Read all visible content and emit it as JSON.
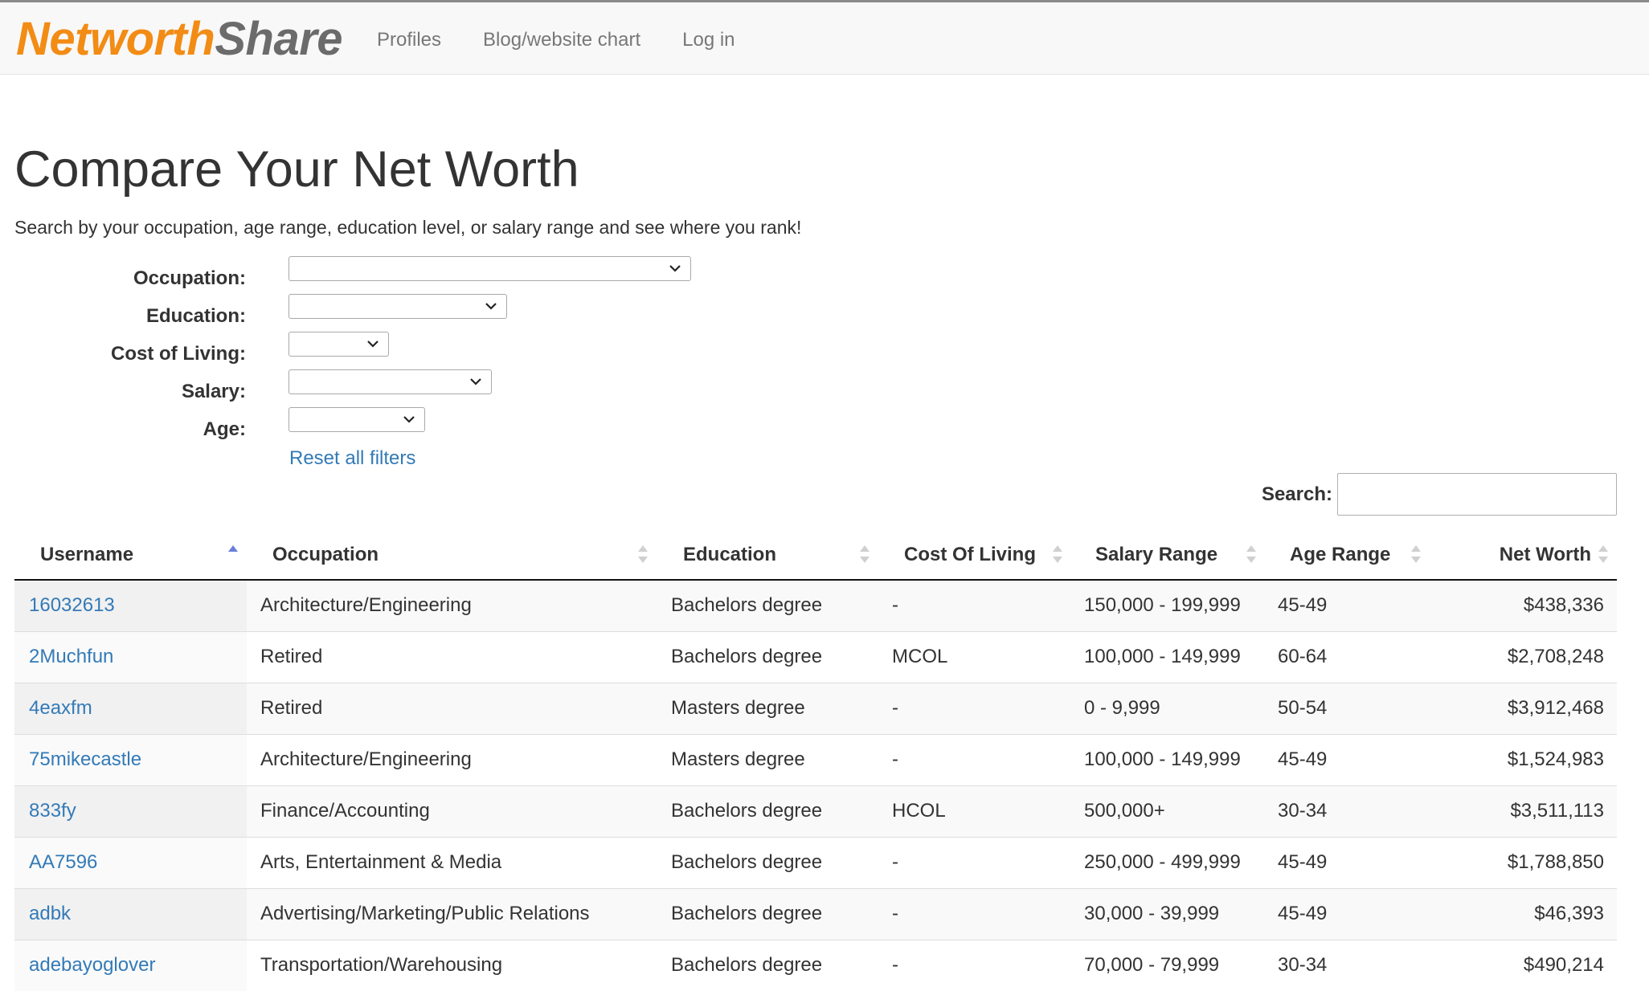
{
  "brand": {
    "part1": "Networth",
    "part2": "Share"
  },
  "nav": {
    "items": [
      "Profiles",
      "Blog/website chart",
      "Log in"
    ]
  },
  "page": {
    "title": "Compare Your Net Worth",
    "subtitle": "Search by your occupation, age range, education level, or salary range and see where you rank!"
  },
  "filters": {
    "occupation_label": "Occupation:",
    "education_label": "Education:",
    "cost_of_living_label": "Cost of Living:",
    "salary_label": "Salary:",
    "age_label": "Age:",
    "reset_label": "Reset all filters"
  },
  "search": {
    "label": "Search:",
    "value": ""
  },
  "table": {
    "columns": [
      "Username",
      "Occupation",
      "Education",
      "Cost Of Living",
      "Salary Range",
      "Age Range",
      "Net Worth"
    ],
    "sorted_column": "Username",
    "sort_direction": "ascending",
    "rows": [
      [
        "16032613",
        "Architecture/Engineering",
        "Bachelors degree",
        "-",
        "150,000 - 199,999",
        "45-49",
        "$438,336"
      ],
      [
        "2Muchfun",
        "Retired",
        "Bachelors degree",
        "MCOL",
        "100,000 - 149,999",
        "60-64",
        "$2,708,248"
      ],
      [
        "4eaxfm",
        "Retired",
        "Masters degree",
        "-",
        "0 - 9,999",
        "50-54",
        "$3,912,468"
      ],
      [
        "75mikecastle",
        "Architecture/Engineering",
        "Masters degree",
        "-",
        "100,000 - 149,999",
        "45-49",
        "$1,524,983"
      ],
      [
        "833fy",
        "Finance/Accounting",
        "Bachelors degree",
        "HCOL",
        "500,000+",
        "30-34",
        "$3,511,113"
      ],
      [
        "AA7596",
        "Arts, Entertainment & Media",
        "Bachelors degree",
        "-",
        "250,000 - 499,999",
        "45-49",
        "$1,788,850"
      ],
      [
        "adbk",
        "Advertising/Marketing/Public Relations",
        "Bachelors degree",
        "-",
        "30,000 - 39,999",
        "45-49",
        "$46,393"
      ],
      [
        "adebayoglover",
        "Transportation/Warehousing",
        "Bachelors degree",
        "-",
        "70,000 - 79,999",
        "30-34",
        "$490,214"
      ]
    ]
  },
  "colors": {
    "brand_orange": "#f28c15",
    "brand_gray": "#6b6b6b",
    "link_blue": "#337ab7",
    "sort_active": "#6b7fd7",
    "sort_inactive": "#d0d0d0"
  },
  "icons": {
    "select_arrow": "chevron-down-icon",
    "sort_active": "sort-asc-icon",
    "sort_inactive": "sort-both-icon"
  }
}
